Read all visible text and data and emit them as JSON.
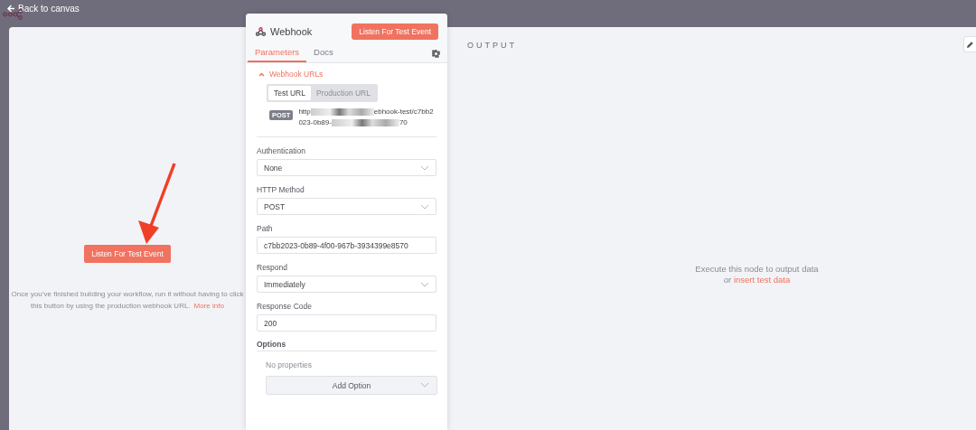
{
  "top_bar": {
    "back_label": "Back to canvas"
  },
  "input_pane": {
    "button": "Listen For Test Event",
    "hint": "Once you’ve finished building your workflow, run it without having to click this button by using the production webhook URL.",
    "link": "More info"
  },
  "node": {
    "title": "Webhook",
    "listen_button": "Listen For Test Event",
    "tabs": [
      {
        "label": "Parameters",
        "selected": true
      },
      {
        "label": "Docs",
        "selected": false
      }
    ],
    "section": {
      "title": "Webhook URLs",
      "expanded": true,
      "url_tabs": [
        {
          "label": "Test URL",
          "selected": true
        },
        {
          "label": "Production URL",
          "selected": false
        }
      ],
      "method": "POST",
      "url_lines": [
        [
          {
            "kind": "text",
            "text": "http"
          },
          {
            "kind": "redacted"
          },
          {
            "kind": "text",
            "text": "ebhook-test/c7bb2"
          }
        ],
        [
          {
            "kind": "text",
            "text": "023-0b89-"
          },
          {
            "kind": "redacted"
          },
          {
            "kind": "text",
            "text": "70"
          }
        ]
      ]
    },
    "fields": [
      {
        "kind": "select",
        "label": "Authentication",
        "value": "None"
      },
      {
        "kind": "select",
        "label": "HTTP Method",
        "value": "POST"
      },
      {
        "kind": "text",
        "label": "Path",
        "value": "c7bb2023-0b89-4f00-967b-3934399e8570"
      },
      {
        "kind": "select",
        "label": "Respond",
        "value": "Immediately"
      },
      {
        "kind": "text",
        "label": "Response Code",
        "value": "200"
      }
    ],
    "options": {
      "title": "Options",
      "empty": "No properties",
      "add": "Add Option"
    }
  },
  "output_pane": {
    "title": "OUTPUT",
    "message": "Execute this node to output data",
    "prefix": "or",
    "link": "insert test data"
  }
}
